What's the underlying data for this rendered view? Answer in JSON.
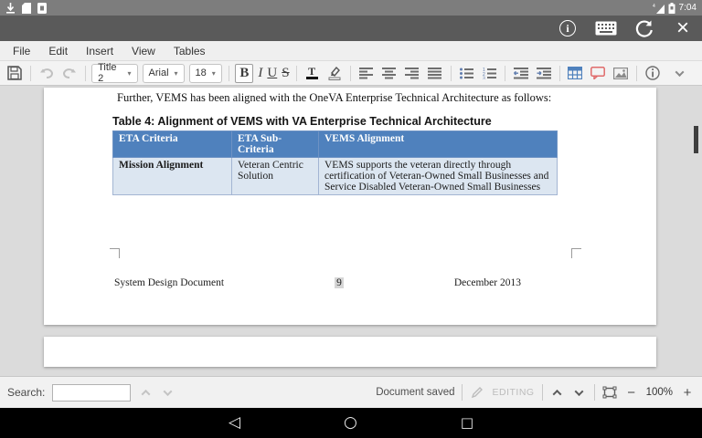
{
  "status_bar": {
    "time": "7:04"
  },
  "menu_bar": {
    "items": [
      "File",
      "Edit",
      "Insert",
      "View",
      "Tables"
    ]
  },
  "toolbar": {
    "style": "Title 2",
    "font": "Arial",
    "size": "18",
    "bold": "B",
    "italic": "I",
    "underline": "U",
    "strike": "S",
    "caret": "▾",
    "text_color": "T"
  },
  "action_bar": {
    "close_glyph": "×"
  },
  "document": {
    "paragraph": "Further, VEMS has been aligned with the OneVA Enterprise Technical Architecture as follows:",
    "caption": "Table 4: Alignment of VEMS with VA Enterprise Technical Architecture",
    "table": {
      "headers": [
        "ETA Criteria",
        "ETA Sub-Criteria",
        "VEMS Alignment"
      ],
      "rows": [
        [
          "Mission Alignment",
          "Veteran Centric Solution",
          "VEMS supports the veteran directly through certification of Veteran-Owned Small Businesses and Service Disabled Veteran-Owned Small Businesses"
        ]
      ]
    },
    "footer": {
      "left": "System Design Document",
      "page_number": "9",
      "right": "December 2013"
    }
  },
  "bottom_bar": {
    "search_label": "Search:",
    "search_value": "",
    "status_text": "Document saved",
    "mode_label": "EDITING",
    "zoom_level": "100%",
    "minus_glyph": "−",
    "plus_glyph": "+"
  },
  "nav_bar": {
    "back_glyph": "◁",
    "home_glyph": "○",
    "recents_glyph": "□"
  },
  "colors": {
    "table_header_bg": "#4f81bd",
    "table_row_bg": "#dce6f1"
  }
}
